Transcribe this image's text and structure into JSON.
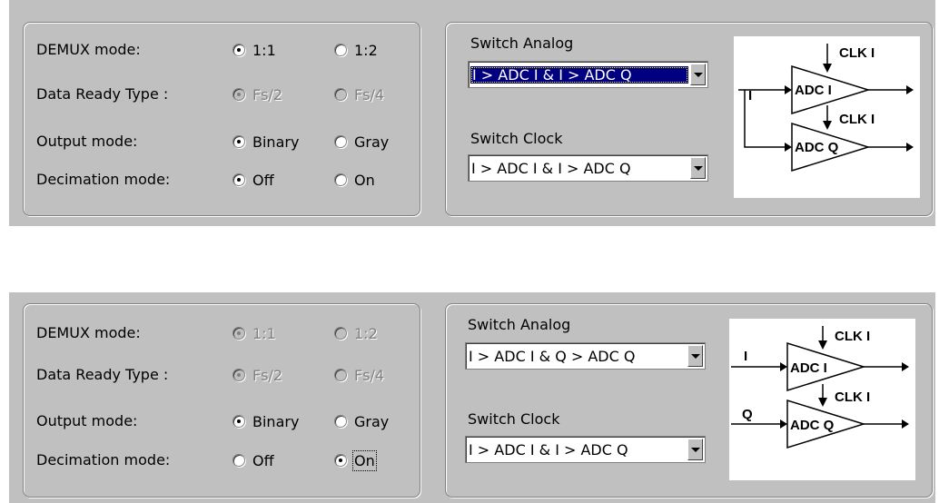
{
  "panels": [
    {
      "demux": {
        "label": "DEMUX mode:",
        "opt1": "1:1",
        "opt2": "1:2"
      },
      "data_ready": {
        "label": "Data Ready Type :",
        "opt1": "Fs/2",
        "opt2": "Fs/4"
      },
      "output": {
        "label": "Output mode:",
        "opt1": "Binary",
        "opt2": "Gray"
      },
      "decimation": {
        "label": "Decimation mode:",
        "opt1": "Off",
        "opt2": "On"
      },
      "switch_analog": {
        "label": "Switch Analog",
        "value": "I > ADC I  &  I > ADC Q"
      },
      "switch_clock": {
        "label": "Switch Clock",
        "value": "I > ADC I  &  I > ADC Q"
      },
      "diagram": {
        "clk_top": "CLK I",
        "clk_bottom": "CLK I",
        "adc_top": "ADC I",
        "adc_bottom": "ADC Q",
        "input_top": "I"
      }
    },
    {
      "demux": {
        "label": "DEMUX mode:",
        "opt1": "1:1",
        "opt2": "1:2"
      },
      "data_ready": {
        "label": "Data Ready Type :",
        "opt1": "Fs/2",
        "opt2": "Fs/4"
      },
      "output": {
        "label": "Output mode:",
        "opt1": "Binary",
        "opt2": "Gray"
      },
      "decimation": {
        "label": "Decimation mode:",
        "opt1": "Off",
        "opt2": "On"
      },
      "switch_analog": {
        "label": "Switch Analog",
        "value": "I > ADC I  &  Q > ADC Q"
      },
      "switch_clock": {
        "label": "Switch Clock",
        "value": "I > ADC I  &  I > ADC Q"
      },
      "diagram": {
        "clk_top": "CLK I",
        "clk_bottom": "CLK I",
        "adc_top": "ADC I",
        "adc_bottom": "ADC Q",
        "input_top": "I",
        "input_bottom": "Q"
      }
    }
  ]
}
